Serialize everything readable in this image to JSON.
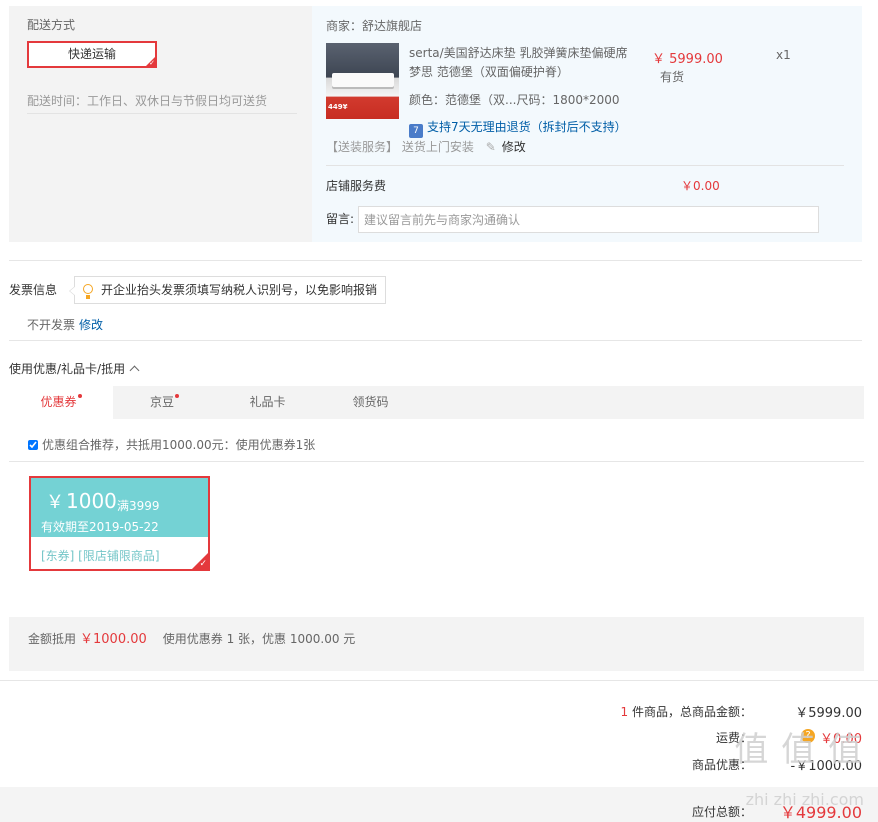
{
  "shipping": {
    "title": "配送方式",
    "method": "快递运输",
    "time": "配送时间：工作日、双休日与节假日均可送货"
  },
  "shop": {
    "name": "商家：舒达旗舰店",
    "product": {
      "thumb_tag": "449¥",
      "title": "serta/美国舒达床垫 乳胶弹簧床垫偏硬席梦思 范德堡（双面偏硬护脊）",
      "spec": "颜色：范德堡（双...尺码：1800*2000",
      "price": "￥ 5999.00",
      "stock": "有货",
      "qty": "x1",
      "return_icon": "7",
      "return_policy": "支持7天无理由退货（拆封后不支持）"
    },
    "service_label": "【送装服务】",
    "service_value": "送货上门安装",
    "service_edit": "修改",
    "fee_label": "店铺服务费",
    "fee_value": "￥0.00",
    "message_label": "留言:",
    "message_placeholder": "建议留言前先与商家沟通确认"
  },
  "invoice": {
    "title": "发票信息",
    "tip": "开企业抬头发票须填写纳税人识别号，以免影响报销",
    "status": "不开发票",
    "edit": "修改"
  },
  "coupons": {
    "title": "使用优惠/礼品卡/抵用",
    "tabs": [
      {
        "label": "优惠券",
        "dot": true
      },
      {
        "label": "京豆",
        "dot": true
      },
      {
        "label": "礼品卡",
        "dot": false
      },
      {
        "label": "领货码",
        "dot": false
      }
    ],
    "combo": "优惠组合推荐，共抵用1000.00元：使用优惠券1张",
    "card": {
      "yen": "￥",
      "amount": "1000",
      "condition": "满3999",
      "valid": "有效期至2019-05-22",
      "tags": "[东券]  [限店铺限商品]"
    },
    "summary_label": "金额抵用",
    "summary_amount": "￥1000.00",
    "summary_text": "使用优惠券 1 张，优惠 1000.00 元"
  },
  "totals": {
    "count": "1",
    "goods_label": "件商品，总商品金额：",
    "goods_value": "￥5999.00",
    "freight_label": "运费：",
    "freight_value": "￥0.00",
    "discount_label": "商品优惠：",
    "discount_value": "-￥1000.00",
    "pay_label": "应付总额：",
    "pay_value": "￥4999.00"
  },
  "watermark": {
    "main": "值 值 值",
    "sub": "zhi zhi zhi.com"
  },
  "colors": {
    "accent": "#e4393c",
    "link": "#005ea7",
    "coupon": "#74d2d4"
  }
}
